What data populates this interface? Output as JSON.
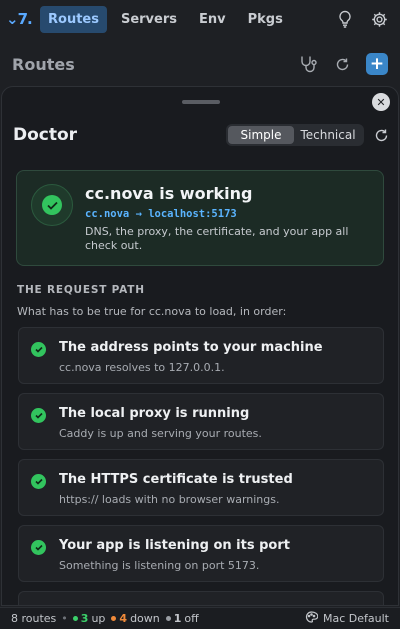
{
  "app": {
    "logo": "⌄7."
  },
  "nav": {
    "tabs": [
      "Routes",
      "Servers",
      "Env",
      "Pkgs"
    ],
    "active": "Routes"
  },
  "routes_header": {
    "title": "Routes",
    "add_label": "+"
  },
  "doctor": {
    "title": "Doctor",
    "modes": [
      "Simple",
      "Technical"
    ],
    "active_mode": "Simple",
    "close_label": "✕",
    "status": {
      "title": "cc.nova is working",
      "target": "cc.nova → localhost:5173",
      "description": "DNS, the proxy, the certificate, and your app all check out."
    },
    "section": {
      "label": "THE REQUEST PATH",
      "subtitle": "What has to be true for cc.nova to load, in order:"
    },
    "checks": [
      {
        "title": "The address points to your machine",
        "detail": "cc.nova resolves to 127.0.0.1."
      },
      {
        "title": "The local proxy is running",
        "detail": "Caddy is up and serving your routes."
      },
      {
        "title": "The HTTPS certificate is trusted",
        "detail": "https:// loads with no browser warnings."
      },
      {
        "title": "Your app is listening on its port",
        "detail": "Something is listening on port 5173."
      }
    ]
  },
  "footer": {
    "routes": "8 routes",
    "up_count": "3",
    "up_label": "up",
    "down_count": "4",
    "down_label": "down",
    "off_count": "1",
    "off_label": "off",
    "theme": "Mac Default"
  },
  "colors": {
    "accent": "#3a86c8",
    "success": "#32c45e",
    "warning": "#f08a3a",
    "link": "#5ab4ff"
  },
  "icons": [
    "lightbulb-icon",
    "gear-icon",
    "stethoscope-icon",
    "refresh-icon",
    "checkmark-icon",
    "palette-icon"
  ]
}
